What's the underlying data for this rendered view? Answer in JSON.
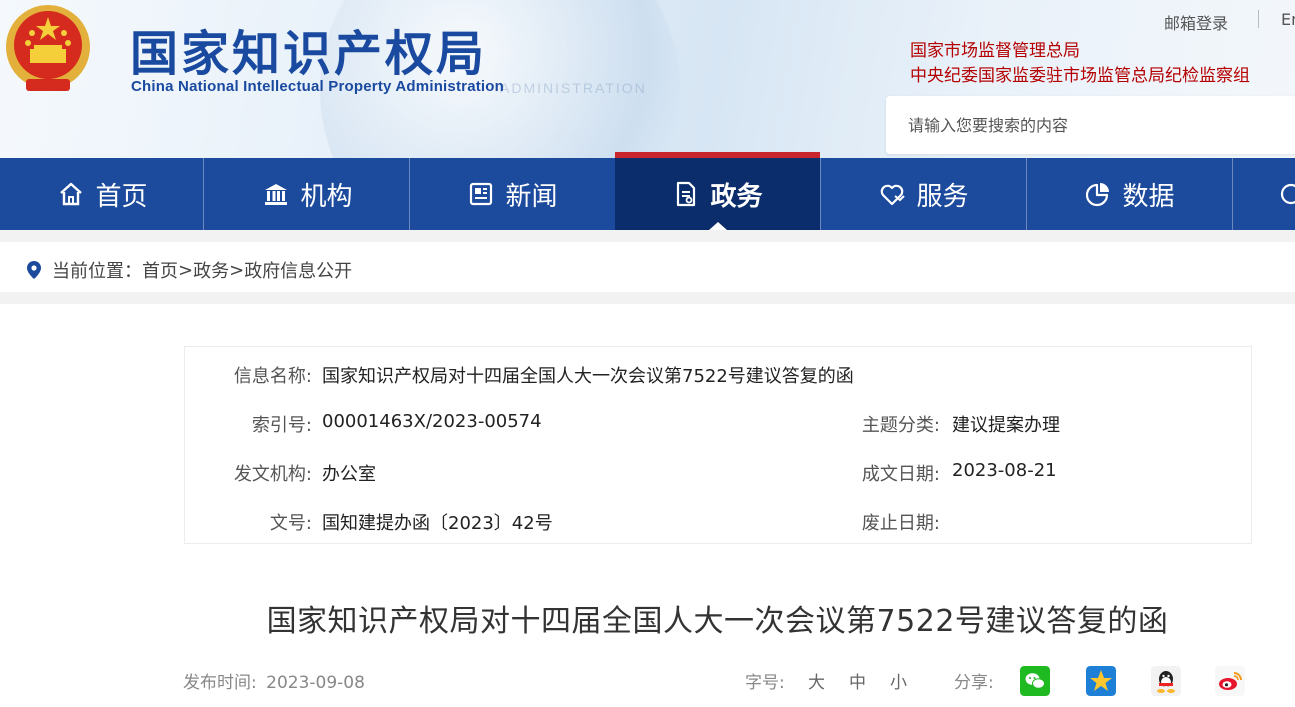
{
  "header": {
    "logo_cn": "国家知识产权局",
    "logo_en": "China National Intellectual Property Administration",
    "watermark": "ADMINISTRATION",
    "mail_login": "邮箱登录",
    "lang": "En",
    "org_links": [
      "国家市场监督管理总局",
      "中央纪委国家监委驻市场监管总局纪检监察组"
    ],
    "search_placeholder": "请输入您要搜索的内容"
  },
  "nav": {
    "items": [
      {
        "label": "首页",
        "icon": "home-icon"
      },
      {
        "label": "机构",
        "icon": "building-icon"
      },
      {
        "label": "新闻",
        "icon": "news-icon"
      },
      {
        "label": "政务",
        "icon": "document-icon",
        "active": true
      },
      {
        "label": "服务",
        "icon": "heart-hand-icon"
      },
      {
        "label": "数据",
        "icon": "pie-chart-icon"
      }
    ]
  },
  "breadcrumb": {
    "prefix": "当前位置：",
    "items": [
      "首页",
      "政务",
      "政府信息公开"
    ],
    "sep": ">"
  },
  "info": {
    "name_label": "信息名称:",
    "name_value": "国家知识产权局对十四届全国人大一次会议第7522号建议答复的函",
    "index_label": "索引号:",
    "index_value": "00001463X/2023-00574",
    "topic_label": "主题分类:",
    "topic_value": "建议提案办理",
    "issuer_label": "发文机构:",
    "issuer_value": "办公室",
    "date_label": "成文日期:",
    "date_value": "2023-08-21",
    "docno_label": "文号:",
    "docno_value": "国知建提办函〔2023〕42号",
    "abolish_label": "废止日期:",
    "abolish_value": ""
  },
  "article": {
    "title": "国家知识产权局对十四届全国人大一次会议第7522号建议答复的函",
    "publish_label": "发布时间:",
    "publish_date": "2023-09-08",
    "font_label": "字号:",
    "font_sizes": [
      "大",
      "中",
      "小"
    ],
    "share_label": "分享:",
    "share_icons": [
      "wechat-icon",
      "qzone-icon",
      "qq-icon",
      "weibo-icon"
    ]
  },
  "colors": {
    "brand_blue": "#1c4a9c",
    "nav_active": "#0c2d6b",
    "accent_red": "#c8252c",
    "org_red": "#b40000"
  }
}
